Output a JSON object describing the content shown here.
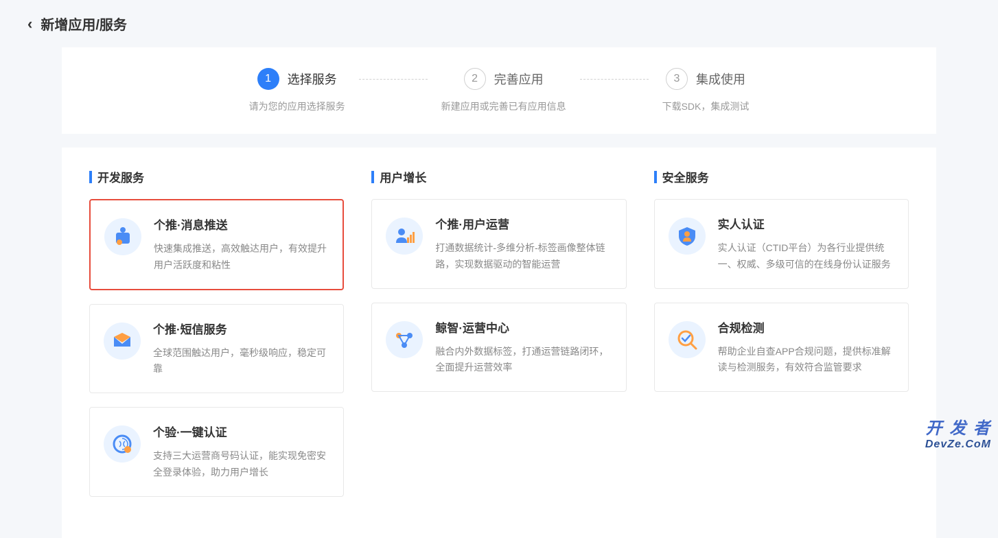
{
  "header": {
    "title": "新增应用/服务"
  },
  "steps": [
    {
      "number": "1",
      "title": "选择服务",
      "desc": "请为您的应用选择服务",
      "active": true
    },
    {
      "number": "2",
      "title": "完善应用",
      "desc": "新建应用或完善已有应用信息",
      "active": false
    },
    {
      "number": "3",
      "title": "集成使用",
      "desc": "下载SDK，集成测试",
      "active": false
    }
  ],
  "sections": [
    {
      "title": "开发服务",
      "cards": [
        {
          "title": "个推·消息推送",
          "desc": "快速集成推送，高效触达用户，有效提升用户活跃度和粘性",
          "icon": "push-icon",
          "highlighted": true
        },
        {
          "title": "个推·短信服务",
          "desc": "全球范围触达用户，毫秒级响应，稳定可靠",
          "icon": "sms-icon",
          "highlighted": false
        },
        {
          "title": "个验·一键认证",
          "desc": "支持三大运营商号码认证，能实现免密安全登录体验，助力用户增长",
          "icon": "auth-icon",
          "highlighted": false
        }
      ]
    },
    {
      "title": "用户增长",
      "cards": [
        {
          "title": "个推·用户运营",
          "desc": "打通数据统计-多维分析-标签画像整体链路，实现数据驱动的智能运营",
          "icon": "user-ops-icon",
          "highlighted": false
        },
        {
          "title": "鲸智·运营中心",
          "desc": "融合内外数据标签，打通运营链路闭环，全面提升运营效率",
          "icon": "whale-icon",
          "highlighted": false
        }
      ]
    },
    {
      "title": "安全服务",
      "cards": [
        {
          "title": "实人认证",
          "desc": "实人认证（CTID平台）为各行业提供统一、权威、多级可信的在线身份认证服务",
          "icon": "identity-icon",
          "highlighted": false
        },
        {
          "title": "合规检测",
          "desc": "帮助企业自查APP合规问题，提供标准解读与检测服务，有效符合监管要求",
          "icon": "compliance-icon",
          "highlighted": false
        }
      ]
    }
  ],
  "watermark": {
    "top": "开 发 者",
    "bottom": "DevZe.CoM"
  }
}
